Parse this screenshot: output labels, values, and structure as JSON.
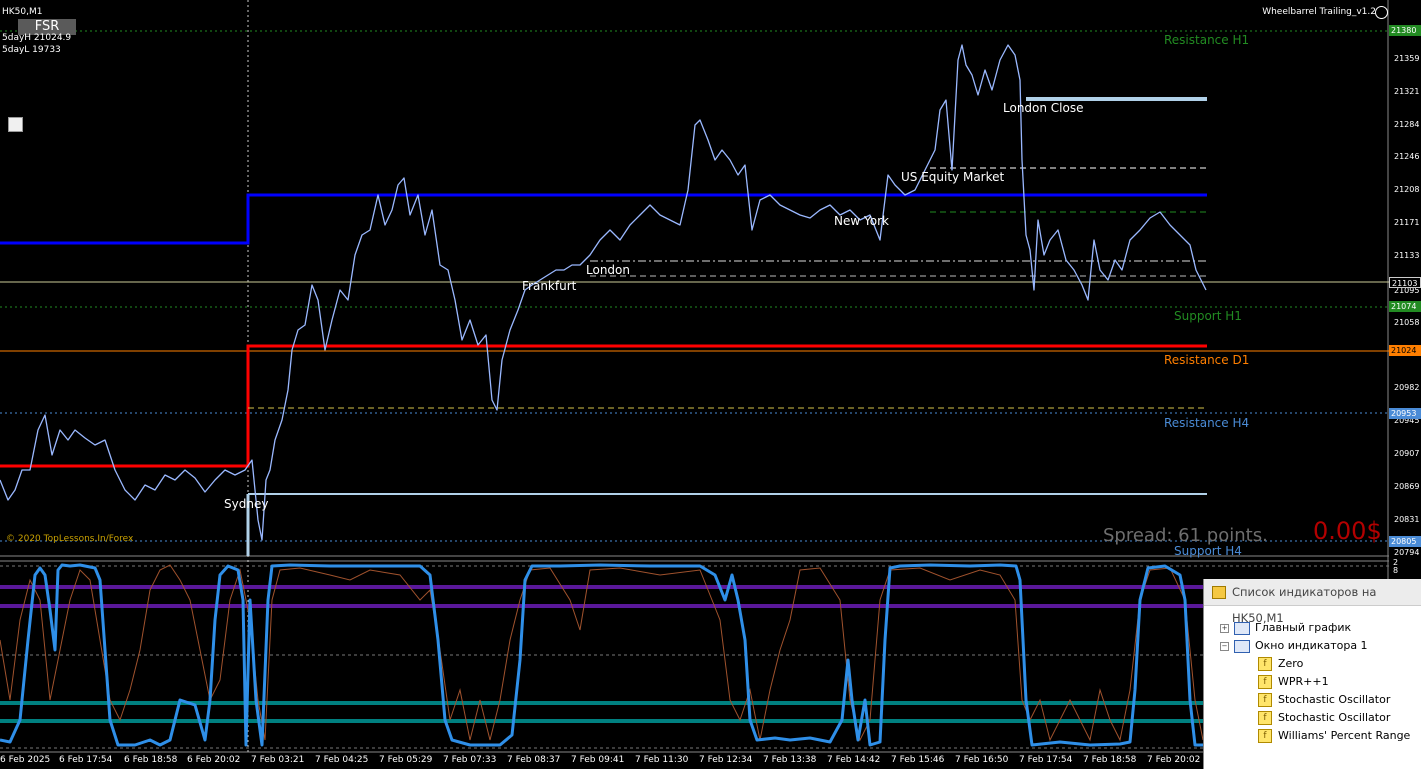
{
  "chart": {
    "symbol": "HK50,M1",
    "button": "FSR",
    "day_high": "5dayH 21024.9",
    "day_low": "5dayL 19733",
    "ea_name": "Wheelbarrel Trailing_v1.2",
    "copyright": "© 2020 TopLessons.In/Forex",
    "spread": "Spread: 61 points.",
    "pnl": "0.00$"
  },
  "levels": {
    "resistance_h1": "Resistance H1",
    "support_h1": "Support H1",
    "resistance_d1": "Resistance D1",
    "resistance_h4": "Resistance H4",
    "support_h4": "Support H4"
  },
  "sessions": {
    "sydney": "Sydney",
    "frankfurt": "Frankfurt",
    "london": "London",
    "new_york": "New York",
    "us_equity": "US Equity Market",
    "london_close": "London Close"
  },
  "price_axis": [
    "21359",
    "21321",
    "21284",
    "21246",
    "21208",
    "21171",
    "21133",
    "21095",
    "21058",
    "20982",
    "20945",
    "20907",
    "20869",
    "20831",
    "20794"
  ],
  "price_tags": {
    "res_h1": "21380",
    "current": "21103",
    "support_h1": "21074",
    "d1": "21024",
    "h4": "20953",
    "low": "20805"
  },
  "time_axis": [
    "6 Feb 2025",
    "6 Feb 17:54",
    "6 Feb 18:58",
    "6 Feb 20:02",
    "7 Feb 03:21",
    "7 Feb 04:25",
    "7 Feb 05:29",
    "7 Feb 07:33",
    "7 Feb 08:37",
    "7 Feb 09:41",
    "7 Feb 11:30",
    "7 Feb 12:34",
    "7 Feb 13:38",
    "7 Feb 14:42",
    "7 Feb 15:46",
    "7 Feb 16:50",
    "7 Feb 17:54",
    "7 Feb 18:58",
    "7 Feb 20:02"
  ],
  "indicator_scale": [
    "2",
    "8"
  ],
  "navigator": {
    "title": "Список индикаторов на HK50,M1",
    "main_chart": "Главный график",
    "window1": "Окно индикатора 1",
    "items": [
      "Zero",
      "WPR++1",
      "Stochastic Oscillator",
      "Stochastic Oscillator",
      "Williams' Percent Range"
    ]
  },
  "colors": {
    "price_line": "#9ab8ff",
    "blue_level": "#0000ff",
    "red_level": "#ff0000",
    "resistance_h1": "#228b22",
    "resistance_d1": "#ff7f00",
    "resistance_h4": "#4a8bd6",
    "indicator_main": "#2f8fe8",
    "indicator_sub": "#a0522d",
    "purple_level": "#5a189a",
    "teal_level": "#008080"
  }
}
